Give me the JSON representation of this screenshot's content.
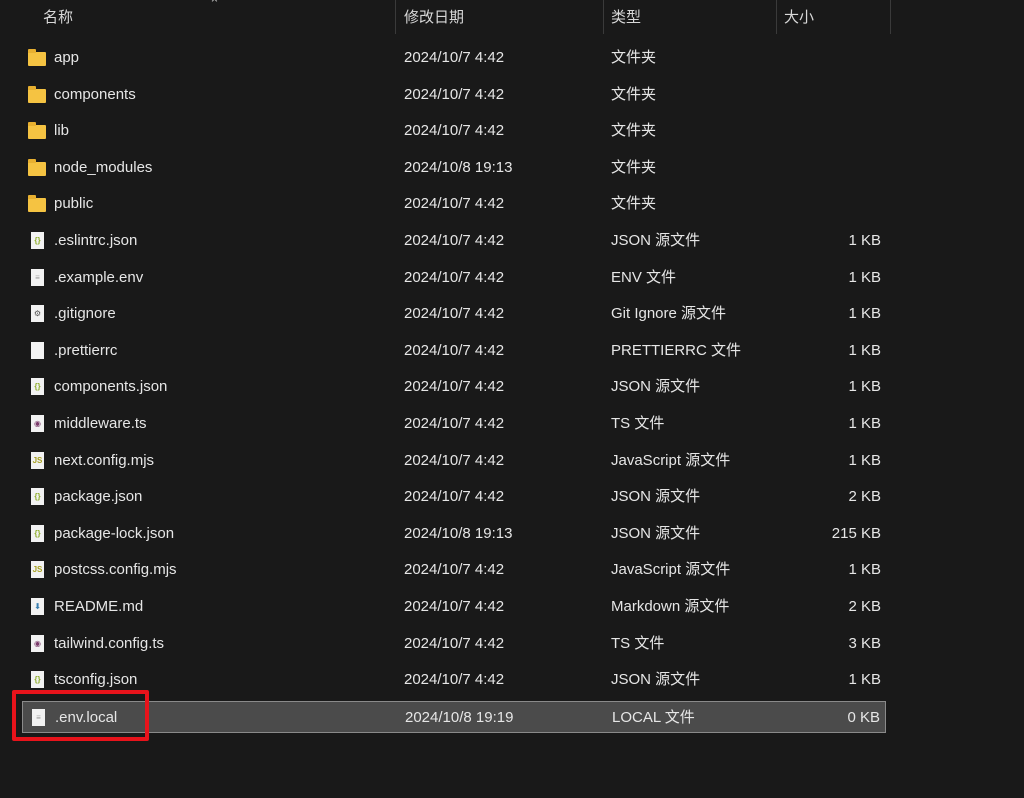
{
  "columns": {
    "name": "名称",
    "date": "修改日期",
    "type": "类型",
    "size": "大小"
  },
  "colors": {
    "highlight": "#e8131b",
    "selected_bg": "#4b4b4b",
    "folder": "#f5c342"
  },
  "files": [
    {
      "name": "app",
      "date": "2024/10/7 4:42",
      "type": "文件夹",
      "size": "",
      "icon": "folder-icon"
    },
    {
      "name": "components",
      "date": "2024/10/7 4:42",
      "type": "文件夹",
      "size": "",
      "icon": "folder-icon"
    },
    {
      "name": "lib",
      "date": "2024/10/7 4:42",
      "type": "文件夹",
      "size": "",
      "icon": "folder-icon"
    },
    {
      "name": "node_modules",
      "date": "2024/10/8 19:13",
      "type": "文件夹",
      "size": "",
      "icon": "folder-icon"
    },
    {
      "name": "public",
      "date": "2024/10/7 4:42",
      "type": "文件夹",
      "size": "",
      "icon": "folder-icon"
    },
    {
      "name": ".eslintrc.json",
      "date": "2024/10/7 4:42",
      "type": "JSON 源文件",
      "size": "1 KB",
      "icon": "json-file-icon"
    },
    {
      "name": ".example.env",
      "date": "2024/10/7 4:42",
      "type": "ENV 文件",
      "size": "1 KB",
      "icon": "text-file-icon"
    },
    {
      "name": ".gitignore",
      "date": "2024/10/7 4:42",
      "type": "Git Ignore 源文件",
      "size": "1 KB",
      "icon": "gear-file-icon"
    },
    {
      "name": ".prettierrc",
      "date": "2024/10/7 4:42",
      "type": "PRETTIERRC 文件",
      "size": "1 KB",
      "icon": "blank-file-icon"
    },
    {
      "name": "components.json",
      "date": "2024/10/7 4:42",
      "type": "JSON 源文件",
      "size": "1 KB",
      "icon": "json-file-icon"
    },
    {
      "name": "middleware.ts",
      "date": "2024/10/7 4:42",
      "type": "TS 文件",
      "size": "1 KB",
      "icon": "ts-file-icon"
    },
    {
      "name": "next.config.mjs",
      "date": "2024/10/7 4:42",
      "type": "JavaScript 源文件",
      "size": "1 KB",
      "icon": "js-file-icon"
    },
    {
      "name": "package.json",
      "date": "2024/10/7 4:42",
      "type": "JSON 源文件",
      "size": "2 KB",
      "icon": "json-file-icon"
    },
    {
      "name": "package-lock.json",
      "date": "2024/10/8 19:13",
      "type": "JSON 源文件",
      "size": "215 KB",
      "icon": "json-file-icon"
    },
    {
      "name": "postcss.config.mjs",
      "date": "2024/10/7 4:42",
      "type": "JavaScript 源文件",
      "size": "1 KB",
      "icon": "js-file-icon"
    },
    {
      "name": "README.md",
      "date": "2024/10/7 4:42",
      "type": "Markdown 源文件",
      "size": "2 KB",
      "icon": "markdown-file-icon"
    },
    {
      "name": "tailwind.config.ts",
      "date": "2024/10/7 4:42",
      "type": "TS 文件",
      "size": "3 KB",
      "icon": "ts-file-icon"
    },
    {
      "name": "tsconfig.json",
      "date": "2024/10/7 4:42",
      "type": "JSON 源文件",
      "size": "1 KB",
      "icon": "json-file-icon"
    },
    {
      "name": ".env.local",
      "date": "2024/10/8 19:19",
      "type": "LOCAL 文件",
      "size": "0 KB",
      "icon": "text-file-icon",
      "selected": true
    }
  ]
}
